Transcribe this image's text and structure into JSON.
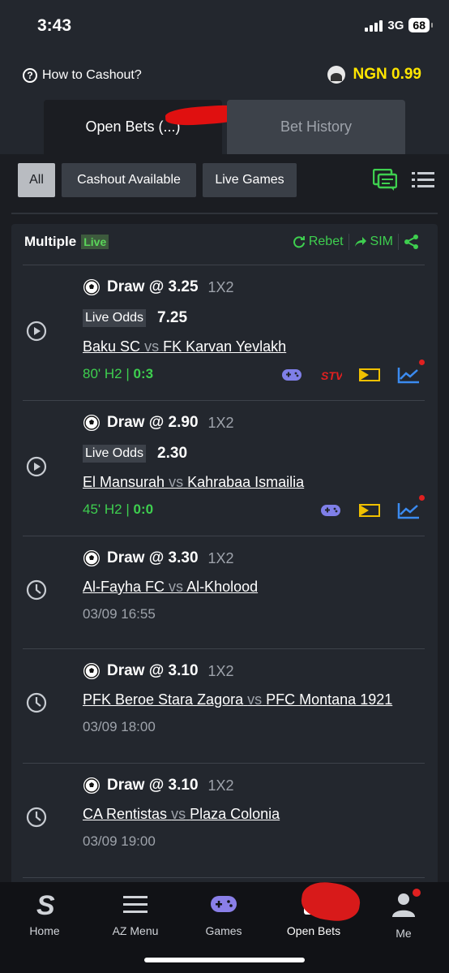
{
  "status_bar": {
    "time": "3:43",
    "network": "3G",
    "battery": "68"
  },
  "header": {
    "how_to_cashout": "How to Cashout?",
    "balance": "NGN 0.99",
    "tabs": [
      {
        "label": "Open Bets (...)",
        "active": true
      },
      {
        "label": "Bet History",
        "active": false
      }
    ]
  },
  "filters": {
    "chips": [
      {
        "label": "All",
        "active": true
      },
      {
        "label": "Cashout Available",
        "active": false
      },
      {
        "label": "Live Games",
        "active": false
      }
    ]
  },
  "bet": {
    "type": "Multiple",
    "live_label": "Live",
    "rebet": "Rebet",
    "sim": "SIM",
    "selections": [
      {
        "status": "live",
        "pick": "Draw @ 3.25",
        "market": "1X2",
        "live_odds_label": "Live Odds",
        "live_odds": "7.25",
        "home": "Baku SC",
        "vs": "vs",
        "away": "FK Karvan Yevlakh",
        "clock": "80' H2 |",
        "score": "0:3"
      },
      {
        "status": "live",
        "pick": "Draw @ 2.90",
        "market": "1X2",
        "live_odds_label": "Live Odds",
        "live_odds": "2.30",
        "home": "El Mansurah",
        "vs": "vs",
        "away": "Kahrabaa Ismailia",
        "clock": "45' H2 |",
        "score": "0:0"
      },
      {
        "status": "upcoming",
        "pick": "Draw @ 3.30",
        "market": "1X2",
        "home": "Al-Fayha FC",
        "vs": "vs",
        "away": "Al-Kholood",
        "kickoff": "03/09 16:55"
      },
      {
        "status": "upcoming",
        "pick": "Draw @ 3.10",
        "market": "1X2",
        "home": "PFK Beroe Stara Zagora",
        "vs": "vs",
        "away": "PFC Montana 1921",
        "kickoff": "03/09 18:00"
      },
      {
        "status": "upcoming",
        "pick": "Draw @ 3.10",
        "market": "1X2",
        "home": "CA Rentistas",
        "vs": "vs",
        "away": "Plaza Colonia",
        "kickoff": "03/09 19:00"
      }
    ]
  },
  "bottom_nav": [
    {
      "label": "Home",
      "icon": "sporty-logo-icon"
    },
    {
      "label": "AZ Menu",
      "icon": "menu-icon"
    },
    {
      "label": "Games",
      "icon": "gamepad-icon"
    },
    {
      "label": "Open Bets",
      "icon": "open-bets-icon",
      "active": true
    },
    {
      "label": "Me",
      "icon": "user-icon"
    }
  ],
  "colors": {
    "accent_green": "#3ecf4f",
    "balance_yellow": "#ffe600",
    "background": "#1b1d22",
    "panel": "#23272e"
  }
}
